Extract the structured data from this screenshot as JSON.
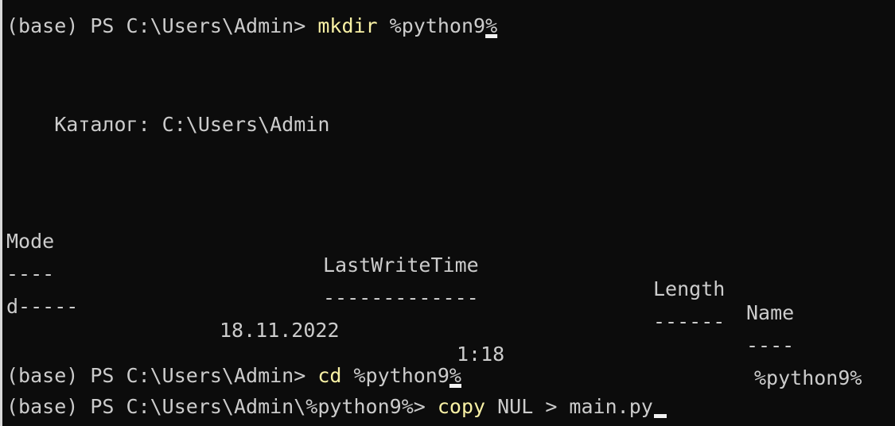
{
  "colors": {
    "background": "#0c0c0c",
    "text": "#cccccc",
    "command": "#f9f1a5",
    "cursor": "#f2f2f2",
    "left_border": "#d9d9d9"
  },
  "line1": {
    "prompt": "(base) PS C:\\Users\\Admin> ",
    "command": "mkdir",
    "argument": " %python9",
    "cursor_char": "%"
  },
  "directory_label": "    Каталог: C:\\Users\\Admin",
  "table": {
    "headers": {
      "mode": "Mode",
      "last_write_time": "LastWriteTime",
      "length": "Length",
      "name": "Name"
    },
    "separators": {
      "mode": "----",
      "last_write_time": "-------------",
      "length": "------",
      "name": "----"
    },
    "rows": [
      {
        "mode": "d-----",
        "date": "18.11.2022",
        "time": "1:18",
        "length": "",
        "name": "%python9%"
      }
    ]
  },
  "line2": {
    "prompt": "(base) PS C:\\Users\\Admin> ",
    "command": "cd",
    "argument": " %python9",
    "cursor_char": "%"
  },
  "line3": {
    "prompt": "(base) PS C:\\Users\\Admin\\%python9%> ",
    "command": "copy",
    "argument": " NUL > main.py"
  }
}
